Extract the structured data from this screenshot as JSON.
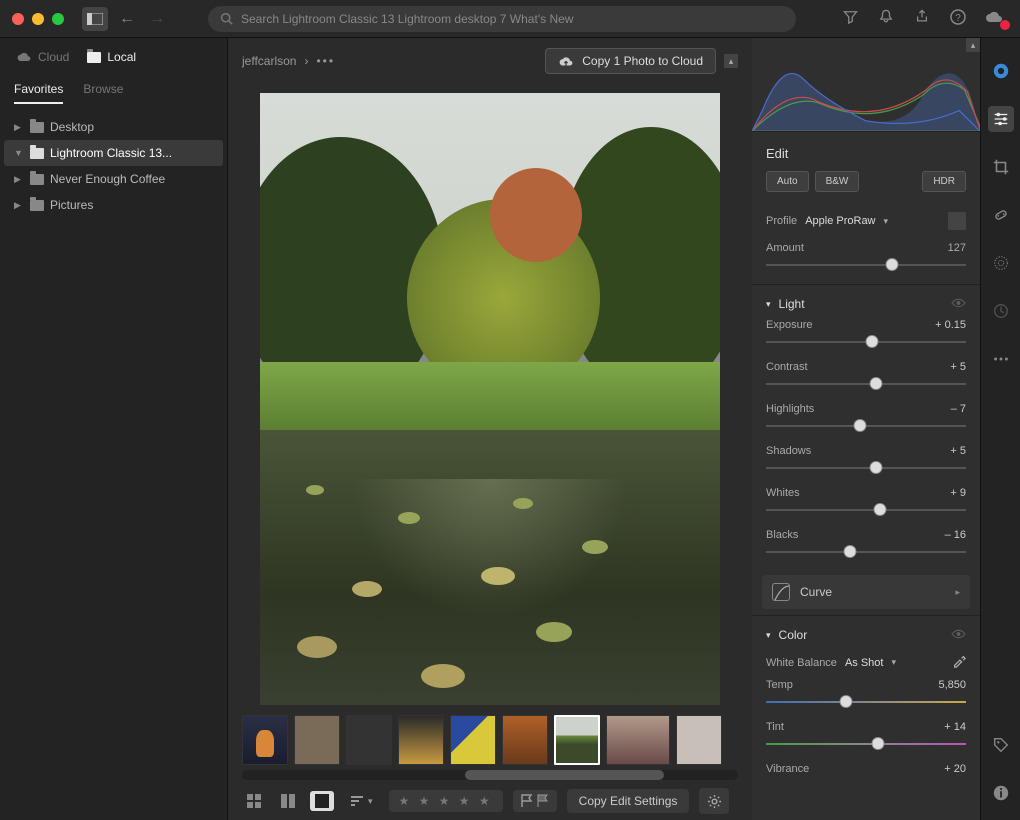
{
  "titlebar": {
    "search_placeholder": "Search Lightroom Classic 13 Lightroom desktop 7 What's New"
  },
  "sidebar": {
    "tabs": {
      "cloud": "Cloud",
      "local": "Local"
    },
    "subtabs": {
      "favorites": "Favorites",
      "browse": "Browse"
    },
    "folders": [
      {
        "label": "Desktop"
      },
      {
        "label": "Lightroom Classic 13..."
      },
      {
        "label": "Never Enough Coffee"
      },
      {
        "label": "Pictures"
      }
    ]
  },
  "breadcrumb": {
    "path": "jeffcarlson",
    "copy_btn": "Copy 1 Photo to Cloud"
  },
  "bottombar": {
    "copy_settings": "Copy Edit Settings"
  },
  "edit": {
    "title": "Edit",
    "auto": "Auto",
    "bw": "B&W",
    "hdr": "HDR",
    "profile_label": "Profile",
    "profile_name": "Apple ProRaw",
    "amount_label": "Amount",
    "amount_value": "127",
    "light": {
      "title": "Light",
      "exposure": {
        "label": "Exposure",
        "value": "+ 0.15",
        "pos": 53
      },
      "contrast": {
        "label": "Contrast",
        "value": "+ 5",
        "pos": 55
      },
      "highlights": {
        "label": "Highlights",
        "value": "– 7",
        "pos": 47
      },
      "shadows": {
        "label": "Shadows",
        "value": "+ 5",
        "pos": 55
      },
      "whites": {
        "label": "Whites",
        "value": "+ 9",
        "pos": 57
      },
      "blacks": {
        "label": "Blacks",
        "value": "– 16",
        "pos": 42
      }
    },
    "curve_label": "Curve",
    "color": {
      "title": "Color",
      "wb_label": "White Balance",
      "wb_value": "As Shot",
      "temp": {
        "label": "Temp",
        "value": "5,850",
        "pos": 40
      },
      "tint": {
        "label": "Tint",
        "value": "+ 14",
        "pos": 56
      },
      "vibrance": {
        "label": "Vibrance",
        "value": "+ 20"
      }
    }
  }
}
